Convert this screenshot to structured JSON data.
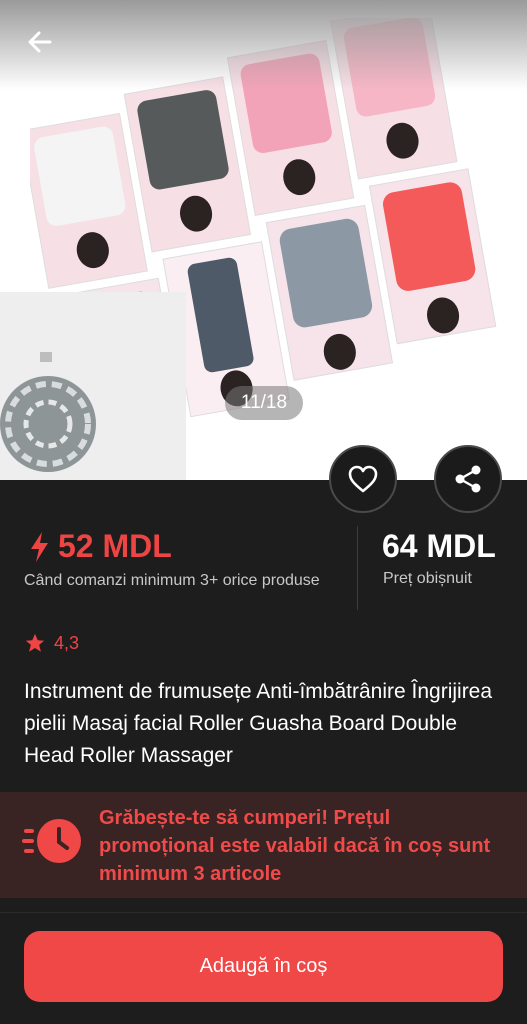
{
  "gallery": {
    "counter": "11/18",
    "icons": {
      "back": "arrow-left-icon",
      "favorite": "heart-icon",
      "share": "share-icon"
    }
  },
  "price": {
    "promo_value": "52 MDL",
    "promo_note": "Când comanzi minimum 3+ orice produse",
    "regular_value": "64 MDL",
    "regular_note": "Preț obișnuit",
    "promo_icon": "lightning-icon"
  },
  "rating": {
    "value": "4,3",
    "icon": "star-icon"
  },
  "product": {
    "title": "Instrument de frumusețe Anti-îmbătrânire Îngrijirea pielii Masaj facial Roller Guasha Board Double Head Roller Massager"
  },
  "promo_banner": {
    "text": "Grăbește-te să cumperi! Prețul promoțional este valabil dacă în coș sunt minimum 3 articole",
    "icon": "fast-clock-icon"
  },
  "actions": {
    "add_to_cart": "Adaugă în coș"
  },
  "colors": {
    "accent": "#f04747",
    "background": "#1d1d1d",
    "banner": "#3a2323"
  }
}
